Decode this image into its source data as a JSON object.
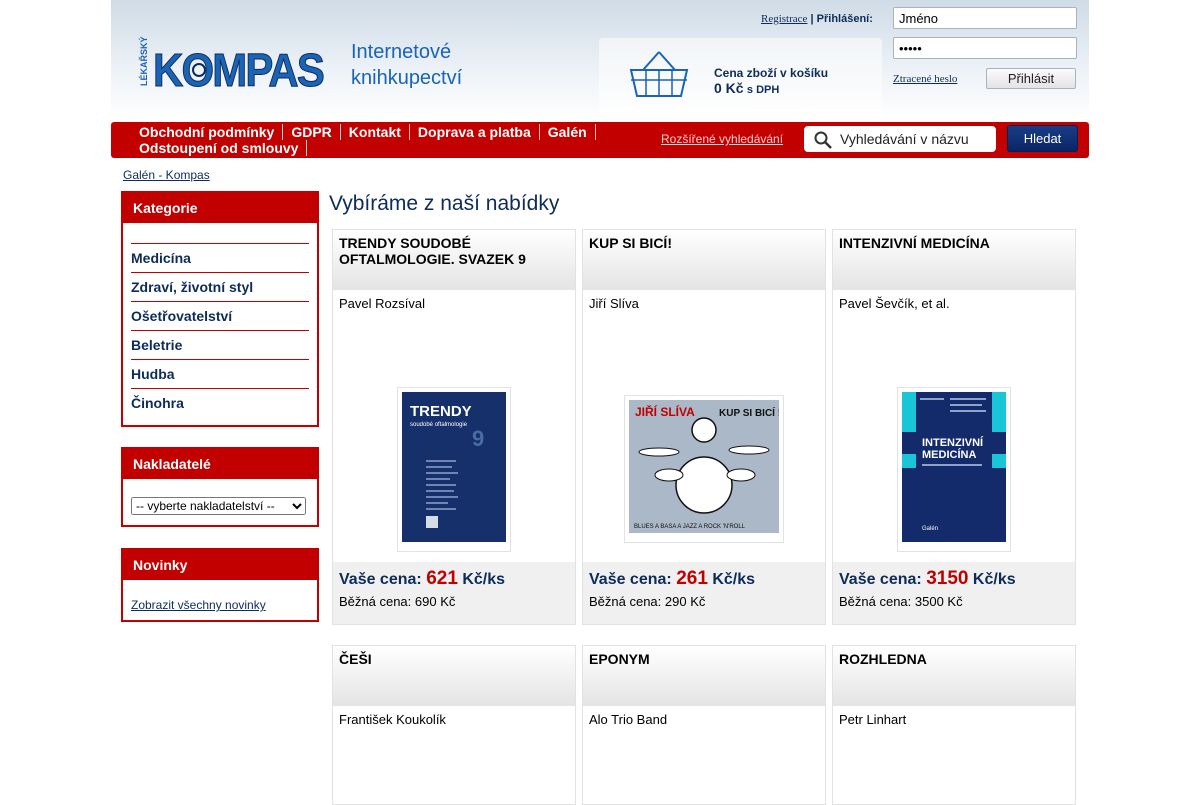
{
  "header": {
    "slogan_line1": "Internetové",
    "slogan_line2": "knihkupectví",
    "register": "Registrace",
    "separator": "|",
    "login_label": "Přihlášení:",
    "name_value": "Jméno",
    "password_value": "•••••",
    "forgot_password": "Ztracené heslo",
    "login_button": "Přihlásit",
    "basket_label": "Cena zboží v košíku",
    "basket_amount": "0 Kč",
    "basket_tax": "s DPH",
    "logo_side_text": "LÉKAŘSKÝ",
    "logo_text": "KOMPAS"
  },
  "nav": {
    "items": [
      "Obchodní podmínky",
      "GDPR",
      "Kontakt",
      "Doprava a platba",
      "Galén",
      "Odstoupení od smlouvy"
    ],
    "advanced_search": "Rozšířené vyhledávání",
    "search_placeholder": "Vyhledávání v názvu",
    "search_button": "Hledat"
  },
  "breadcrumb": "Galén - Kompas",
  "sidebar": {
    "categories_title": "Kategorie",
    "categories": [
      "Medicína",
      "Zdraví, životní styl",
      "Ošetřovatelství",
      "Beletrie",
      "Hudba",
      "Činohra"
    ],
    "publishers_title": "Nakladatelé",
    "publishers_select": "-- vyberte nakladatelství --",
    "news_title": "Novinky",
    "news_link": "Zobrazit všechny novinky"
  },
  "main": {
    "title": "Vybíráme z naší nabídky",
    "price_label": "Vaše cena:",
    "price_unit": "Kč/ks",
    "products": [
      {
        "title": "TRENDY SOUDOBÉ OFTALMOLOGIE. SVAZEK 9",
        "author": "Pavel Rozsíval",
        "price": "621",
        "regular": "Běžná cena: 690 Kč",
        "cover_title": "TRENDY",
        "cover_sub": "soudobé oftalmologie",
        "cover_color": "#16306b"
      },
      {
        "title": "KUP SI BICÍ!",
        "author": "Jiří Slíva",
        "price": "261",
        "regular": "Běžná cena: 290 Kč",
        "cover_title": "JIŘÍ SLÍVA",
        "cover_sub": "KUP SI BICÍ !",
        "cover_footer": "BLUES A BASA A JAZZ A ROCK 'N'ROLL",
        "cover_color": "#aab8c8"
      },
      {
        "title": "INTENZIVNÍ MEDICÍNA",
        "author": "Pavel Ševčík, et al.",
        "price": "3150",
        "regular": "Běžná cena: 3500 Kč",
        "cover_title": "INTENZIVNÍ",
        "cover_sub": "MEDICÍNA",
        "cover_footer": "Galén",
        "cover_color": "#132a6b"
      },
      {
        "title": "ČEŠI",
        "author": "František Koukolík"
      },
      {
        "title": "EPONYM",
        "author": "Alo Trio Band"
      },
      {
        "title": "ROZHLEDNA",
        "author": "Petr Linhart"
      }
    ]
  },
  "colors": {
    "brand_red": "#c20000",
    "navy": "#0d2c5a",
    "logo_blue": "#1a63b5"
  }
}
